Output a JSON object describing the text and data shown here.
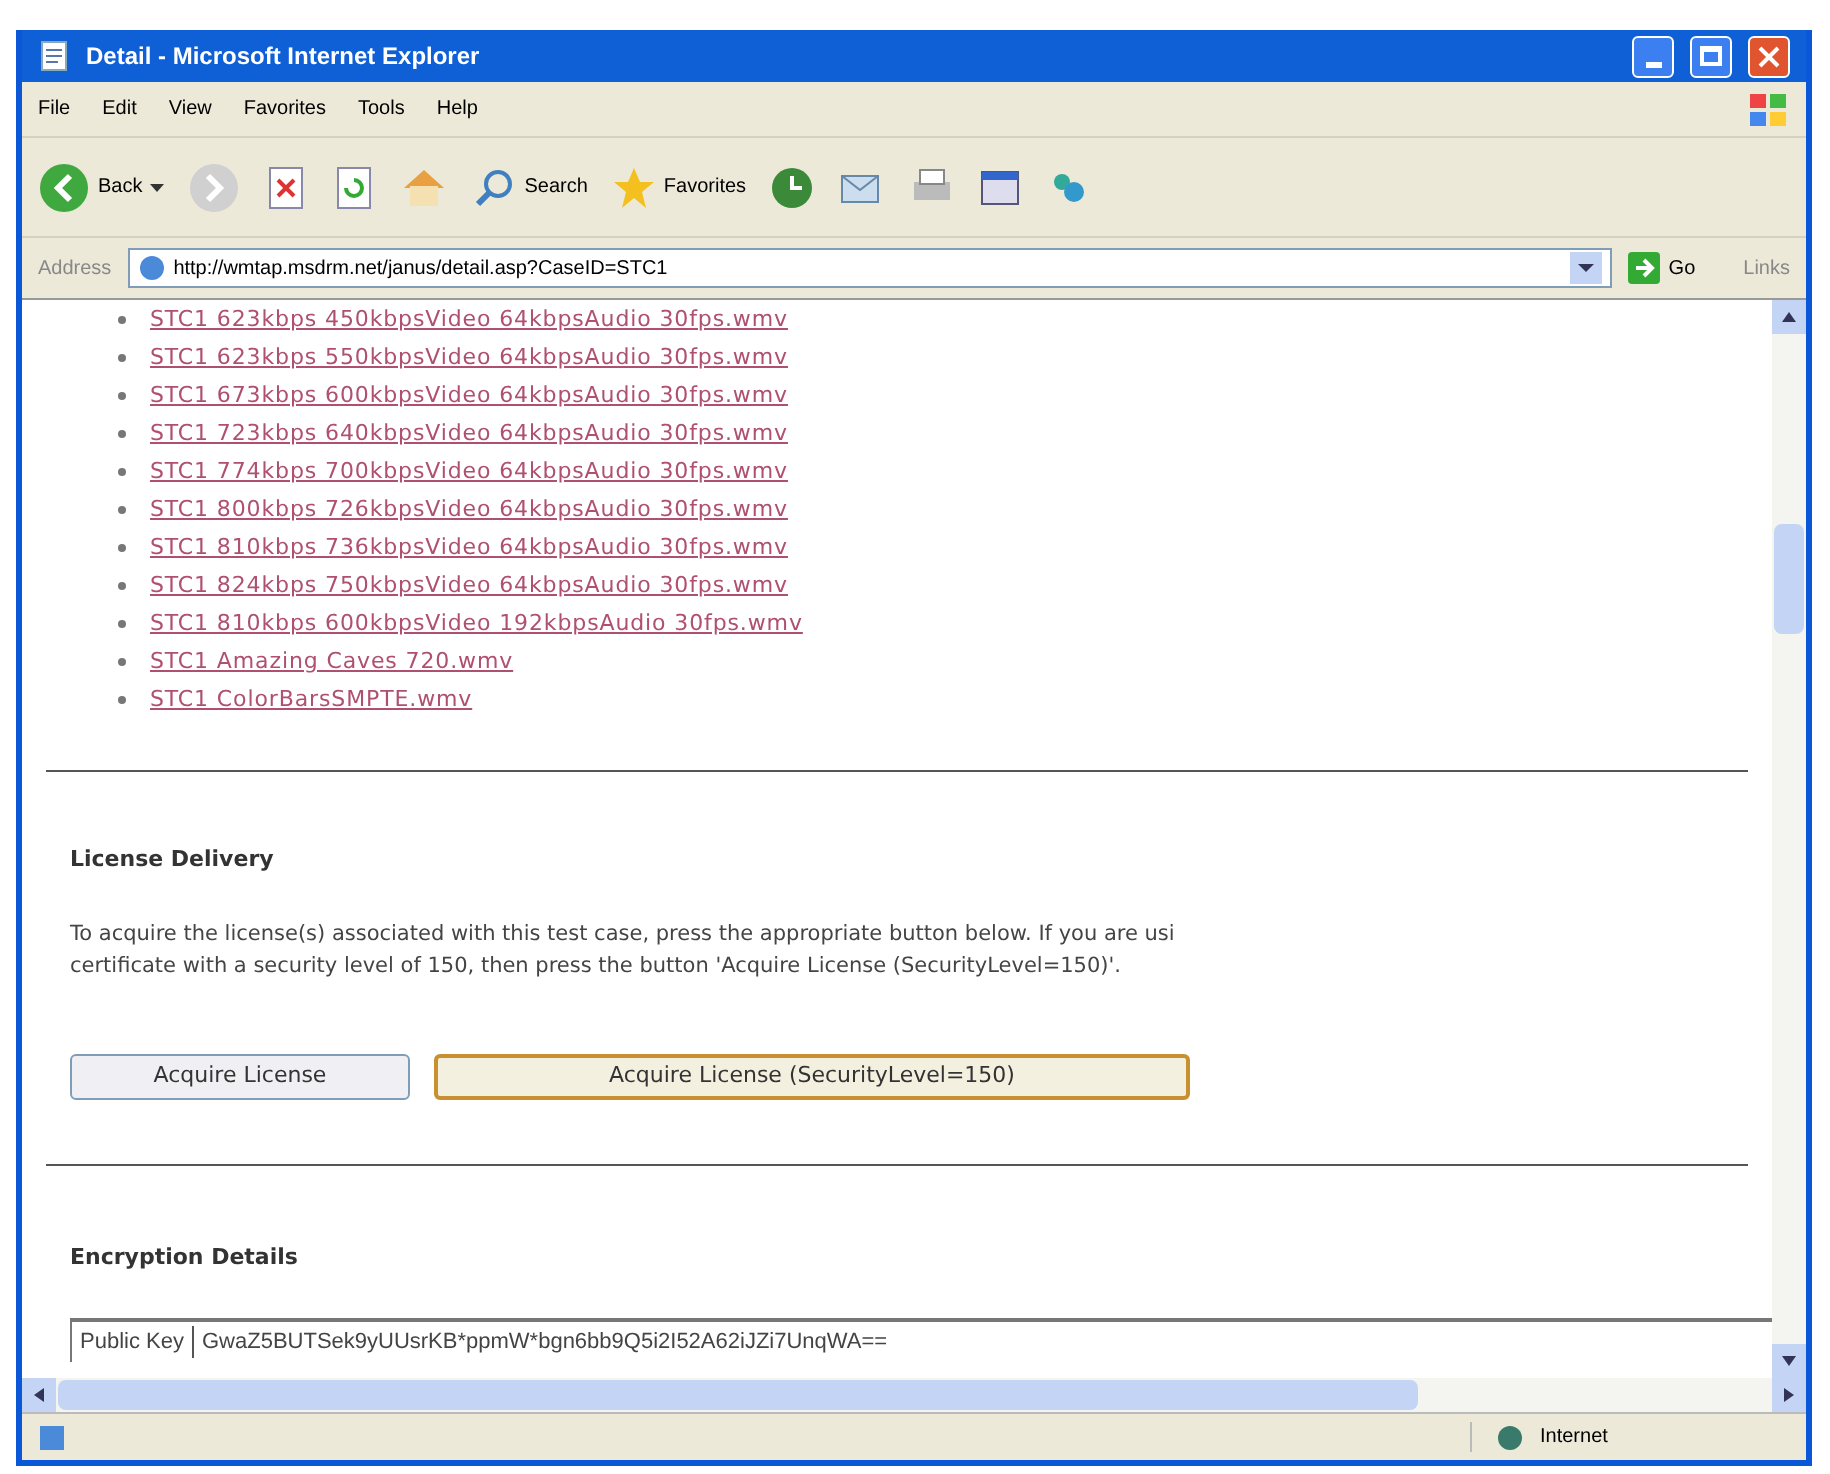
{
  "window": {
    "title": "Detail - Microsoft Internet Explorer"
  },
  "menu": [
    "File",
    "Edit",
    "View",
    "Favorites",
    "Tools",
    "Help"
  ],
  "toolbar": {
    "back": "Back",
    "search": "Search",
    "favorites": "Favorites"
  },
  "address_bar": {
    "label": "Address",
    "value": "http://wmtap.msdrm.net/janus/detail.asp?CaseID=STC1",
    "go": "Go",
    "links": "Links"
  },
  "links": [
    "STC1 623kbps 450kbpsVideo 64kbpsAudio 30fps.wmv",
    "STC1 623kbps 550kbpsVideo 64kbpsAudio 30fps.wmv",
    "STC1 673kbps 600kbpsVideo 64kbpsAudio 30fps.wmv",
    "STC1 723kbps 640kbpsVideo 64kbpsAudio 30fps.wmv",
    "STC1 774kbps 700kbpsVideo 64kbpsAudio 30fps.wmv",
    "STC1 800kbps 726kbpsVideo 64kbpsAudio 30fps.wmv",
    "STC1 810kbps 736kbpsVideo 64kbpsAudio 30fps.wmv",
    "STC1 824kbps 750kbpsVideo 64kbpsAudio 30fps.wmv",
    "STC1 810kbps 600kbpsVideo 192kbpsAudio 30fps.wmv",
    "STC1 Amazing Caves 720.wmv",
    "STC1 ColorBarsSMPTE.wmv"
  ],
  "license": {
    "heading": "License Delivery",
    "text": "To acquire the license(s) associated with this test case, press the appropriate button below. If you are usi",
    "text_2": "certificate with a security level of 150, then press the button 'Acquire License (SecurityLevel=150)'.",
    "buttons": [
      {
        "label": "Acquire License",
        "selected": false
      },
      {
        "label": "Acquire License (SecurityLevel=150)",
        "selected": true
      }
    ]
  },
  "encryption": {
    "heading": "Encryption Details",
    "key_label": "Public Key",
    "key_value": "GwaZ5BUTSek9yUUsrKB*ppmW*bgn6bb9Q5i2I52A62iJZi7UnqWA=="
  },
  "status_bar": {
    "zone": "Internet"
  }
}
